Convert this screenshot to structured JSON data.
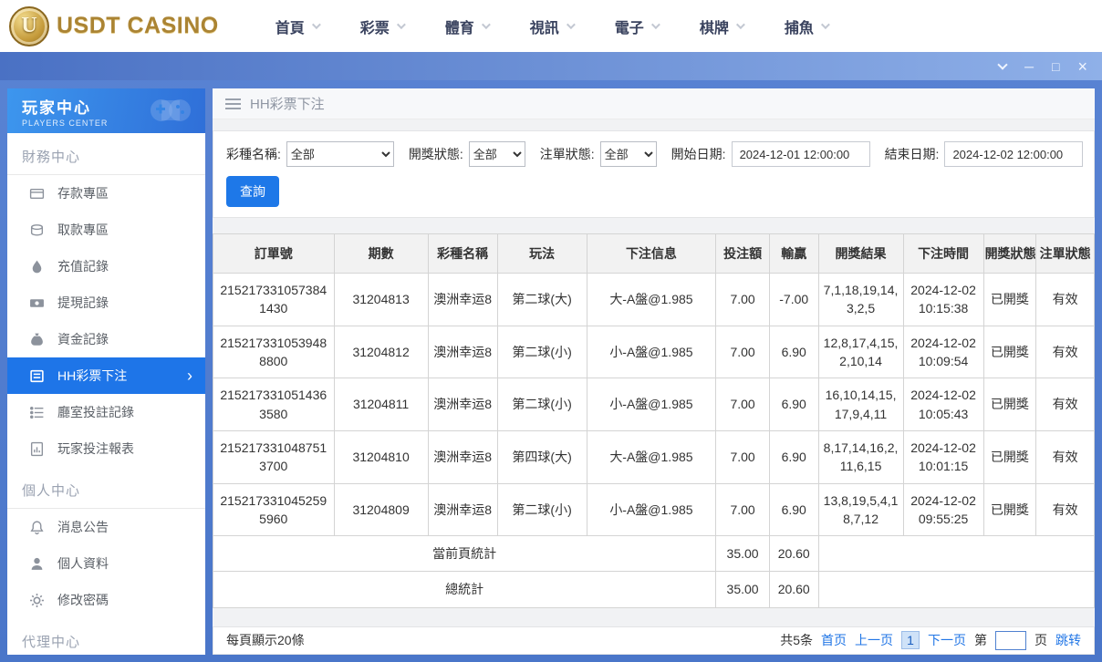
{
  "theme": {
    "accent_blue": "#1e75e8",
    "brand_gold": "#ab8433",
    "titlebar_gradient": [
      "#4a71c4",
      "#8fb0e8"
    ],
    "link_blue": "#2176e6"
  },
  "topbar": {
    "logo": {
      "badge_letter": "U",
      "text": "USDT CASINO"
    },
    "nav": [
      {
        "name": "home",
        "label": "首頁"
      },
      {
        "name": "lottery",
        "label": "彩票"
      },
      {
        "name": "sports",
        "label": "體育"
      },
      {
        "name": "video",
        "label": "視訊"
      },
      {
        "name": "slots",
        "label": "電子"
      },
      {
        "name": "chess-cards",
        "label": "棋牌"
      },
      {
        "name": "fishing",
        "label": "捕魚"
      }
    ]
  },
  "titlebar": {
    "minimize_glyph": "─",
    "maximize_glyph": "□",
    "close_glyph": "×"
  },
  "sidebar": {
    "header": {
      "title": "玩家中心",
      "subtitle": "PLAYERS CENTER"
    },
    "sections": [
      {
        "label": "財務中心",
        "items": [
          {
            "name": "deposit",
            "label": "存款專區",
            "icon": "deposit-icon",
            "active": false
          },
          {
            "name": "withdraw",
            "label": "取款專區",
            "icon": "withdraw-icon",
            "active": false
          },
          {
            "name": "recharge-record",
            "label": "充值記錄",
            "icon": "recharge-record-icon",
            "active": false
          },
          {
            "name": "cashout-record",
            "label": "提現記錄",
            "icon": "cashout-record-icon",
            "active": false
          },
          {
            "name": "funds-record",
            "label": "資金記錄",
            "icon": "funds-record-icon",
            "active": false
          },
          {
            "name": "hh-lottery-bets",
            "label": "HH彩票下注",
            "icon": "lottery-bet-icon",
            "active": true
          },
          {
            "name": "hall-bet-record",
            "label": "廳室投註記錄",
            "icon": "hall-bet-record-icon",
            "active": false
          },
          {
            "name": "player-bet-report",
            "label": "玩家投注報表",
            "icon": "player-report-icon",
            "active": false
          }
        ]
      },
      {
        "label": "個人中心",
        "items": [
          {
            "name": "announcements",
            "label": "消息公告",
            "icon": "announcement-icon",
            "active": false
          },
          {
            "name": "profile",
            "label": "個人資料",
            "icon": "profile-icon",
            "active": false
          },
          {
            "name": "change-password",
            "label": "修改密碼",
            "icon": "password-icon",
            "active": false
          }
        ]
      },
      {
        "label": "代理中心",
        "items": []
      }
    ]
  },
  "breadcrumb": {
    "title": "HH彩票下注"
  },
  "filters": {
    "fields": [
      {
        "label": "彩種名稱:",
        "type": "select",
        "value": "全部"
      },
      {
        "label": "開獎狀態:",
        "type": "select",
        "value": "全部"
      },
      {
        "label": "注單狀態:",
        "type": "select",
        "value": "全部"
      },
      {
        "label": "開始日期:",
        "type": "input",
        "value": "2024-12-01 12:00:00"
      },
      {
        "label": "結束日期:",
        "type": "input",
        "value": "2024-12-02 12:00:00"
      }
    ],
    "search_label": "查詢"
  },
  "table": {
    "columns": [
      "訂單號",
      "期數",
      "彩種名稱",
      "玩法",
      "下注信息",
      "投注額",
      "輸贏",
      "開獎結果",
      "下注時間",
      "開獎狀態",
      "注單狀態"
    ],
    "rows": [
      [
        "2152173310573841430",
        "31204813",
        "澳洲幸运8",
        "第二球(大)",
        "大-A盤@1.985",
        "7.00",
        "-7.00",
        "7,1,18,19,14,3,2,5",
        "2024-12-02 10:15:38",
        "已開獎",
        "有效"
      ],
      [
        "2152173310539488800",
        "31204812",
        "澳洲幸运8",
        "第二球(小)",
        "小-A盤@1.985",
        "7.00",
        "6.90",
        "12,8,17,4,15,2,10,14",
        "2024-12-02 10:09:54",
        "已開獎",
        "有效"
      ],
      [
        "2152173310514363580",
        "31204811",
        "澳洲幸运8",
        "第二球(小)",
        "小-A盤@1.985",
        "7.00",
        "6.90",
        "16,10,14,15,17,9,4,11",
        "2024-12-02 10:05:43",
        "已開獎",
        "有效"
      ],
      [
        "2152173310487513700",
        "31204810",
        "澳洲幸运8",
        "第四球(大)",
        "大-A盤@1.985",
        "7.00",
        "6.90",
        "8,17,14,16,2,11,6,15",
        "2024-12-02 10:01:15",
        "已開獎",
        "有效"
      ],
      [
        "2152173310452595960",
        "31204809",
        "澳洲幸运8",
        "第二球(小)",
        "小-A盤@1.985",
        "7.00",
        "6.90",
        "13,8,19,5,4,18,7,12",
        "2024-12-02 09:55:25",
        "已開獎",
        "有效"
      ]
    ],
    "summary_rows": [
      {
        "label": "當前頁統計",
        "bet_total": "35.00",
        "winloss_total": "20.60"
      },
      {
        "label": "總統計",
        "bet_total": "35.00",
        "winloss_total": "20.60"
      }
    ]
  },
  "footer": {
    "page_size_text": "每頁顯示20條",
    "pagination": {
      "total_text": "共5条",
      "first_label": "首页",
      "prev_label": "上一页",
      "current_page": "1",
      "next_label": "下一页",
      "jump_pre": "第",
      "jump_post": "页",
      "jump_button": "跳转",
      "jump_value": ""
    }
  }
}
